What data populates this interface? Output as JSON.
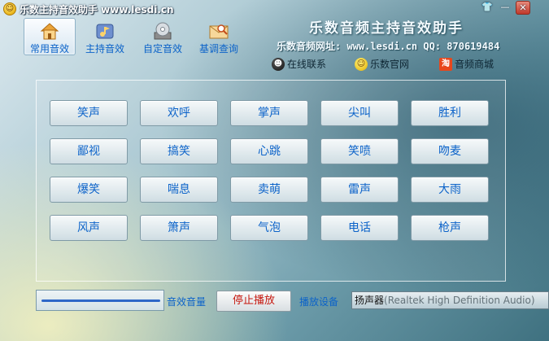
{
  "window": {
    "title": "乐数主持音效助手 www.lesdi.cn",
    "controls": [
      "skin",
      "minimize",
      "close"
    ]
  },
  "toolbar": [
    {
      "label": "常用音效",
      "icon": "home-icon",
      "active": true
    },
    {
      "label": "主持音效",
      "icon": "music-icon",
      "active": false
    },
    {
      "label": "自定音效",
      "icon": "disc-icon",
      "active": false
    },
    {
      "label": "基调查询",
      "icon": "search-mail-icon",
      "active": false
    }
  ],
  "brand": {
    "title": "乐数音频主持音效助手",
    "url_line": "乐数音频网址: www.lesdi.cn QQ: 870619484"
  },
  "contacts": [
    {
      "label": "在线联系",
      "icon": "qq-icon"
    },
    {
      "label": "乐数官网",
      "icon": "smiley-icon"
    },
    {
      "label": "音频商城",
      "icon": "taobao-icon"
    }
  ],
  "sounds": [
    [
      "笑声",
      "欢呼",
      "掌声",
      "尖叫",
      "胜利"
    ],
    [
      "鄙视",
      "搞笑",
      "心跳",
      "笑喷",
      "吻麦"
    ],
    [
      "爆笑",
      "喘息",
      "卖萌",
      "雷声",
      "大雨"
    ],
    [
      "风声",
      "箫声",
      "气泡",
      "电话",
      "枪声"
    ]
  ],
  "bottom": {
    "volume_label": "音效音量",
    "stop_label": "停止播放",
    "device_label": "播放设备",
    "device_value": "扬声器",
    "device_rest": "(Realtek High Definition Audio)"
  },
  "colors": {
    "accent_text": "#0c63c9",
    "stop_text": "#c6180f",
    "volume_bar": "#2e67c8"
  }
}
